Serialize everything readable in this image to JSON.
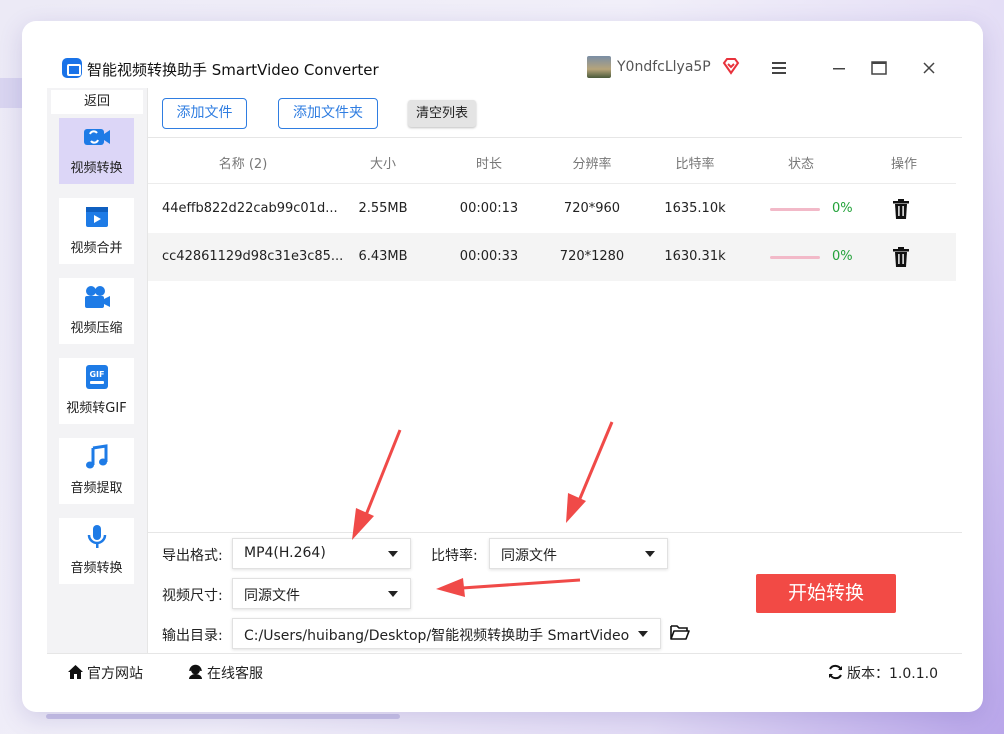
{
  "app": {
    "title": "智能视频转换助手 SmartVideo Converter",
    "username": "Y0ndfcLlya5P"
  },
  "sidebar": {
    "back_label": "返回",
    "items": [
      {
        "label": "视频转换",
        "icon": "video-convert-icon",
        "active": true
      },
      {
        "label": "视频合并",
        "icon": "video-merge-icon",
        "active": false
      },
      {
        "label": "视频压缩",
        "icon": "video-compress-icon",
        "active": false
      },
      {
        "label": "视频转GIF",
        "icon": "gif-icon",
        "active": false
      },
      {
        "label": "音频提取",
        "icon": "music-note-icon",
        "active": false
      },
      {
        "label": "音频转换",
        "icon": "microphone-icon",
        "active": false
      }
    ]
  },
  "toolbar": {
    "add_file": "添加文件",
    "add_folder": "添加文件夹",
    "clear_list": "清空列表"
  },
  "table": {
    "headers": [
      "名称 (2)",
      "大小",
      "时长",
      "分辨率",
      "比特率",
      "状态",
      "操作"
    ],
    "rows": [
      {
        "name": "44effb822d22cab99c01d...",
        "size": "2.55MB",
        "duration": "00:00:13",
        "resolution": "720*960",
        "bitrate": "1635.10k",
        "progress": "0%",
        "progress_value": 0
      },
      {
        "name": "cc42861129d98c31e3c85...",
        "size": "6.43MB",
        "duration": "00:00:33",
        "resolution": "720*1280",
        "bitrate": "1630.31k",
        "progress": "0%",
        "progress_value": 0
      }
    ]
  },
  "settings": {
    "format_label": "导出格式:",
    "format_value": "MP4(H.264)",
    "bitrate_label": "比特率:",
    "bitrate_value": "同源文件",
    "size_label": "视频尺寸:",
    "size_value": "同源文件",
    "output_label": "输出目录:",
    "output_value": "C:/Users/huibang/Desktop/智能视频转换助手 SmartVideo",
    "start_label": "开始转换"
  },
  "footer": {
    "website": "官方网站",
    "support": "在线客服",
    "version": "版本：1.0.1.0"
  },
  "colors": {
    "accent": "#2f7de1",
    "start_button": "#f24a45",
    "active_nav": "#dcd6f7",
    "progress_text": "#23a23a",
    "arrow": "#f04a48"
  }
}
